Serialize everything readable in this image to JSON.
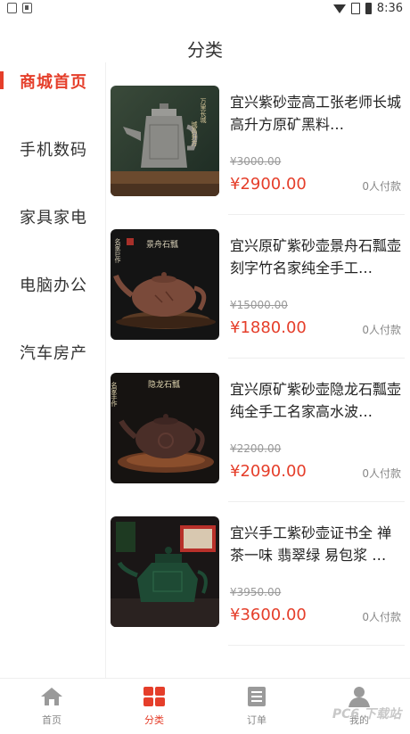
{
  "status": {
    "time": "8:36"
  },
  "header": {
    "title": "分类"
  },
  "sidebar": {
    "items": [
      {
        "label": "商城首页",
        "active": true
      },
      {
        "label": "手机数码",
        "active": false
      },
      {
        "label": "家具家电",
        "active": false
      },
      {
        "label": "电脑办公",
        "active": false
      },
      {
        "label": "汽车房产",
        "active": false
      }
    ]
  },
  "products": [
    {
      "title": "宜兴紫砂壶高工张老师长城高升方原矿黑料…",
      "old_price": "¥3000.00",
      "price": "¥2900.00",
      "paid": "0人付款",
      "image_text": [
        "万里长城",
        "城高升方"
      ]
    },
    {
      "title": "宜兴原矿紫砂壶景舟石瓢壶刻字竹名家纯全手工…",
      "old_price": "¥15000.00",
      "price": "¥1880.00",
      "paid": "0人付款",
      "image_text": [
        "景舟石瓢",
        "名家巨作"
      ]
    },
    {
      "title": "宜兴原矿紫砂壶隐龙石瓢壶纯全手工名家高水波…",
      "old_price": "¥2200.00",
      "price": "¥2090.00",
      "paid": "0人付款",
      "image_text": [
        "隐龙石瓢",
        "名家手作"
      ]
    },
    {
      "title": "宜兴手工紫砂壶证书全 禅茶一味 翡翠绿 易包浆 …",
      "old_price": "¥3950.00",
      "price": "¥3600.00",
      "paid": "0人付款",
      "image_text": []
    }
  ],
  "tabbar": {
    "tabs": [
      {
        "label": "首页",
        "icon": "home-icon",
        "active": false
      },
      {
        "label": "分类",
        "icon": "category-icon",
        "active": true
      },
      {
        "label": "订单",
        "icon": "order-icon",
        "active": false
      },
      {
        "label": "我的",
        "icon": "user-icon",
        "active": false
      }
    ]
  },
  "watermark": "PC6 下载站",
  "colors": {
    "accent": "#e53e2a",
    "text": "#222222",
    "muted": "#888888"
  }
}
